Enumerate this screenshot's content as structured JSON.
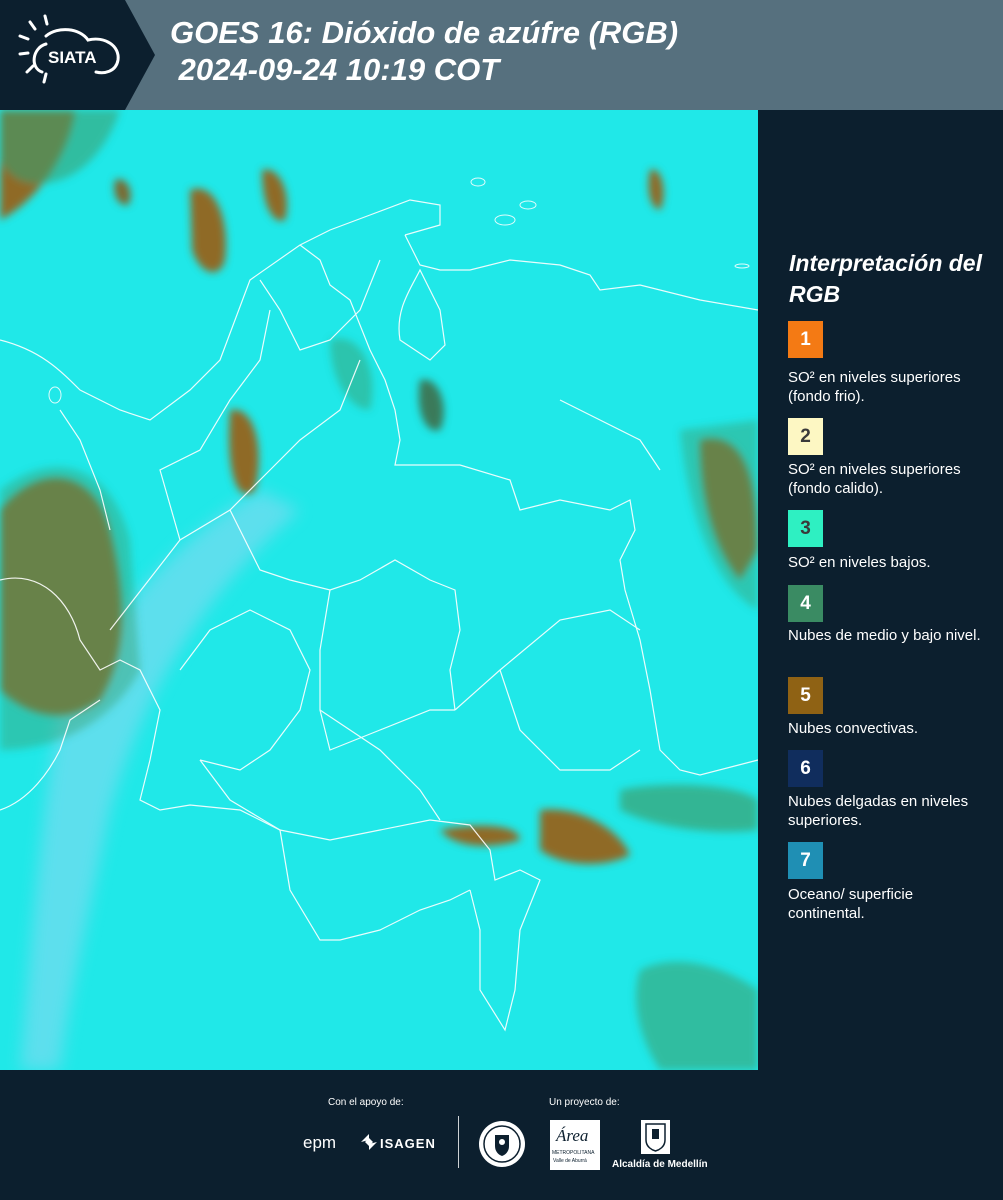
{
  "header": {
    "logo_text": "SIATA",
    "title": "GOES 16: Dióxido de azúfre (RGB)\n 2024-09-24 10:19 COT"
  },
  "legend": {
    "title": "Interpretación del RGB",
    "items": [
      {
        "number": "1",
        "color": "#f47a14",
        "num_color": "#ffffff",
        "text": "SO² en niveles superiores (fondo frio)."
      },
      {
        "number": "2",
        "color": "#fdf7c3",
        "num_color": "#3a3a3a",
        "text": "SO² en niveles superiores (fondo calido)."
      },
      {
        "number": "3",
        "color": "#2ef0c2",
        "num_color": "#3a3a3a",
        "text": "SO² en niveles bajos."
      },
      {
        "number": "4",
        "color": "#3a8b63",
        "num_color": "#ffffff",
        "text": "Nubes de medio y bajo nivel."
      },
      {
        "number": "5",
        "color": "#8f6214",
        "num_color": "#ffffff",
        "text": "Nubes convectivas."
      },
      {
        "number": "6",
        "color": "#102d5d",
        "num_color": "#ffffff",
        "text": "Nubes delgadas en niveles superiores."
      },
      {
        "number": "7",
        "color": "#1f8fb4",
        "num_color": "#ffffff",
        "text": "Oceano/ superficie continental."
      }
    ]
  },
  "footer": {
    "support_label": "Con el apoyo de:",
    "project_label": "Un proyecto de:",
    "epm": "epm",
    "isagen": "ISAGEN",
    "area_name": "Área",
    "area_sub": "METROPOLITANA",
    "area_sub2": "Valle de Aburrá",
    "alcaldia": "Alcaldía de Medellín"
  },
  "map": {
    "background_color": "#20e8e8",
    "cloud_convective": "#8f6a28",
    "cloud_low": "#3aa070",
    "border_color": "#ffffff"
  }
}
